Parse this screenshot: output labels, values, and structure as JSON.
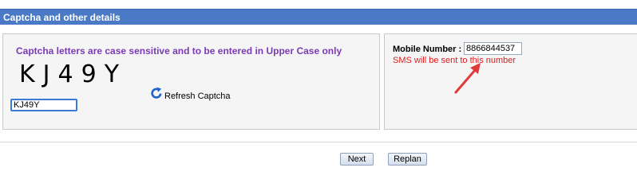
{
  "section": {
    "title": "Captcha and other details"
  },
  "captcha": {
    "instruction": "Captcha letters are case sensitive and to be entered in Upper Case only",
    "image_text": "KJ49Y",
    "input_value": "KJ49Y",
    "refresh_label": "Refresh Captcha",
    "refresh_icon": "refresh-icon"
  },
  "mobile": {
    "label": "Mobile Number :",
    "value": "8866844537",
    "note": "SMS will be sent to this number"
  },
  "buttons": {
    "next": "Next",
    "replan": "Replan"
  },
  "colors": {
    "header": "#4a79c6",
    "instruction": "#7b3bb5",
    "note": "#e01b1b",
    "arrow": "#e03b3b",
    "refresh_icon": "#1f63c9"
  }
}
